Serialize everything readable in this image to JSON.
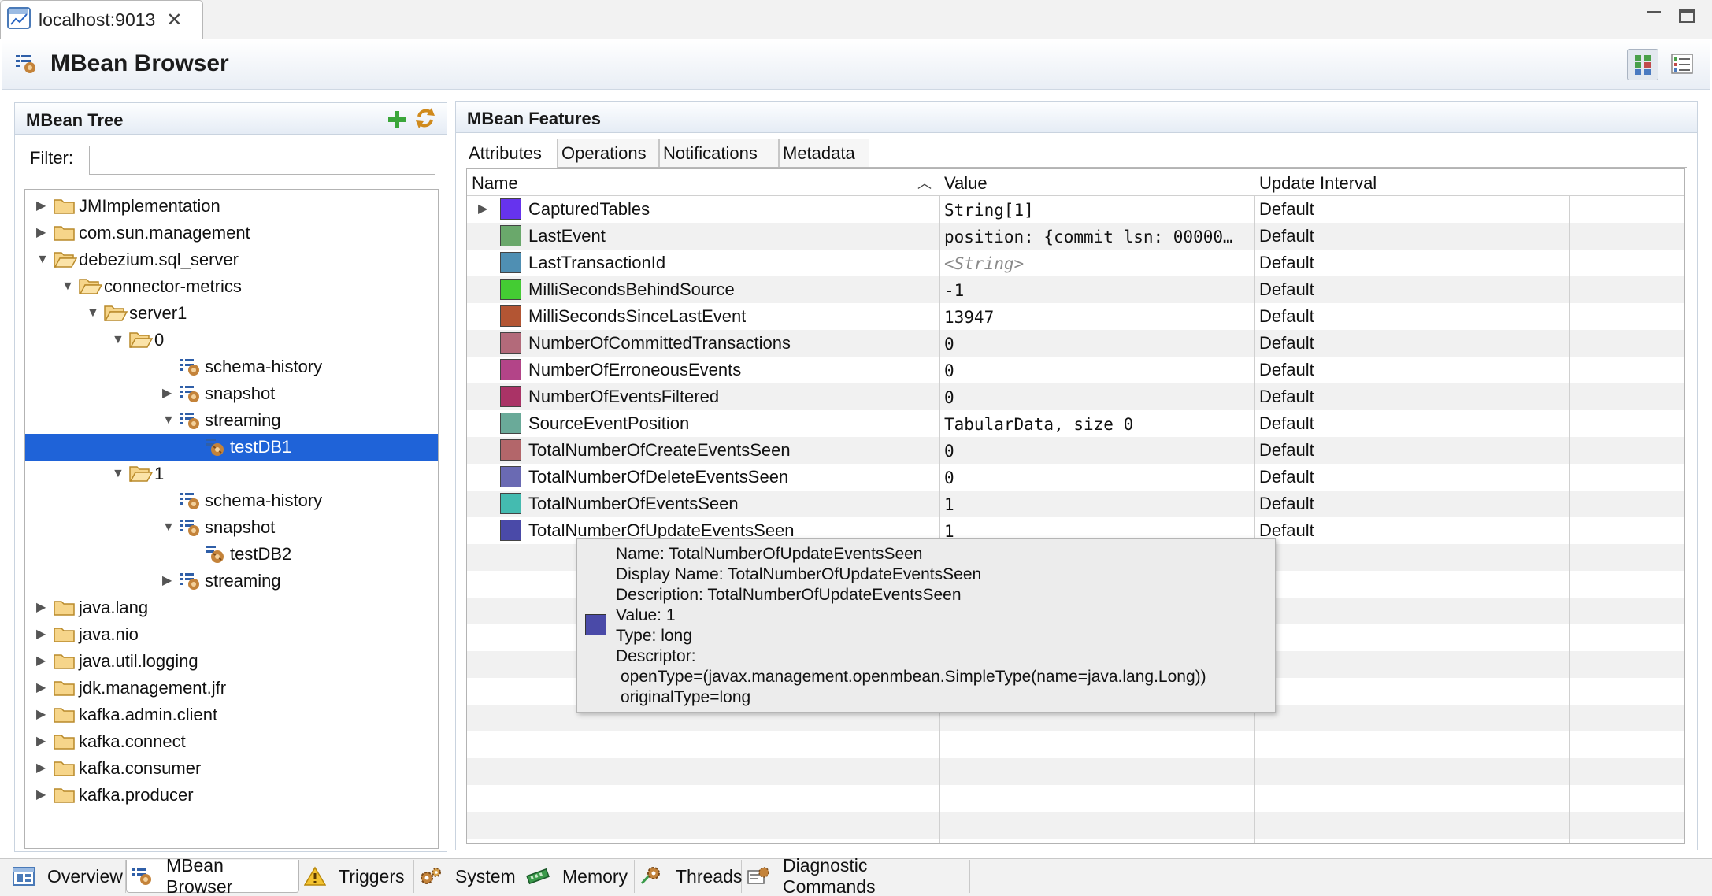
{
  "window": {
    "tab_title": "localhost:9013"
  },
  "header": {
    "title": "MBean Browser"
  },
  "tree_panel": {
    "title": "MBean Tree",
    "filter_label": "Filter:",
    "filter_value": "",
    "items": [
      {
        "label": "JMImplementation",
        "type": "folder",
        "expanded": false
      },
      {
        "label": "com.sun.management",
        "type": "folder",
        "expanded": false
      },
      {
        "label": "debezium.sql_server",
        "type": "folder",
        "expanded": true
      },
      {
        "label": "connector-metrics",
        "type": "folder",
        "expanded": true
      },
      {
        "label": "server1",
        "type": "folder",
        "expanded": true
      },
      {
        "label": "0",
        "type": "folder",
        "expanded": true
      },
      {
        "label": "schema-history",
        "type": "bean"
      },
      {
        "label": "snapshot",
        "type": "bean",
        "expanded": false
      },
      {
        "label": "streaming",
        "type": "bean",
        "expanded": true
      },
      {
        "label": "testDB1",
        "type": "mbean",
        "selected": true
      },
      {
        "label": "1",
        "type": "folder",
        "expanded": true
      },
      {
        "label": "schema-history",
        "type": "bean"
      },
      {
        "label": "snapshot",
        "type": "bean",
        "expanded": true
      },
      {
        "label": "testDB2",
        "type": "mbean"
      },
      {
        "label": "streaming",
        "type": "bean",
        "expanded": false
      },
      {
        "label": "java.lang",
        "type": "folder",
        "expanded": false
      },
      {
        "label": "java.nio",
        "type": "folder",
        "expanded": false
      },
      {
        "label": "java.util.logging",
        "type": "folder",
        "expanded": false
      },
      {
        "label": "jdk.management.jfr",
        "type": "folder",
        "expanded": false
      },
      {
        "label": "kafka.admin.client",
        "type": "folder",
        "expanded": false
      },
      {
        "label": "kafka.connect",
        "type": "folder",
        "expanded": false
      },
      {
        "label": "kafka.consumer",
        "type": "folder",
        "expanded": false
      },
      {
        "label": "kafka.producer",
        "type": "folder",
        "expanded": false
      }
    ]
  },
  "features_panel": {
    "title": "MBean Features",
    "tabs": [
      "Attributes",
      "Operations",
      "Notifications",
      "Metadata"
    ],
    "active_tab": "Attributes",
    "columns": [
      "Name",
      "Value",
      "Update Interval"
    ],
    "rows": [
      {
        "name": "CapturedTables",
        "value": "String[1]",
        "interval": "Default",
        "color": "#6633ee",
        "expandable": true
      },
      {
        "name": "LastEvent",
        "value": "position: {commit_lsn: 00000…",
        "interval": "Default",
        "color": "#6aa86b"
      },
      {
        "name": "LastTransactionId",
        "value": "<String>",
        "interval": "Default",
        "color": "#4f8fb3",
        "placeholder": true
      },
      {
        "name": "MilliSecondsBehindSource",
        "value": "-1",
        "interval": "Default",
        "color": "#44cc33"
      },
      {
        "name": "MilliSecondsSinceLastEvent",
        "value": "13947",
        "interval": "Default",
        "color": "#b35533"
      },
      {
        "name": "NumberOfCommittedTransactions",
        "value": "0",
        "interval": "Default",
        "color": "#b36a7a"
      },
      {
        "name": "NumberOfErroneousEvents",
        "value": "0",
        "interval": "Default",
        "color": "#b34488"
      },
      {
        "name": "NumberOfEventsFiltered",
        "value": "0",
        "interval": "Default",
        "color": "#aa3366"
      },
      {
        "name": "SourceEventPosition",
        "value": "TabularData, size 0",
        "interval": "Default",
        "color": "#6aaa99"
      },
      {
        "name": "TotalNumberOfCreateEventsSeen",
        "value": "0",
        "interval": "Default",
        "color": "#b3666a"
      },
      {
        "name": "TotalNumberOfDeleteEventsSeen",
        "value": "0",
        "interval": "Default",
        "color": "#6a6ab3"
      },
      {
        "name": "TotalNumberOfEventsSeen",
        "value": "1",
        "interval": "Default",
        "color": "#44bbb0"
      },
      {
        "name": "TotalNumberOfUpdateEventsSeen",
        "value": "1",
        "interval": "Default",
        "color": "#4a4aa8"
      }
    ]
  },
  "tooltip": {
    "lines": [
      "Name: TotalNumberOfUpdateEventsSeen",
      "Display Name: TotalNumberOfUpdateEventsSeen",
      "Description: TotalNumberOfUpdateEventsSeen",
      "Value: 1",
      "Type: long",
      "Descriptor:",
      " openType=(javax.management.openmbean.SimpleType(name=java.lang.Long))",
      " originalType=long"
    ],
    "color": "#4a4aa8"
  },
  "bottom_tabs": [
    {
      "label": "Overview",
      "icon": "overview-icon"
    },
    {
      "label": "MBean Browser",
      "icon": "mbean-icon",
      "active": true
    },
    {
      "label": "Triggers",
      "icon": "warning-icon"
    },
    {
      "label": "System",
      "icon": "gears-icon"
    },
    {
      "label": "Memory",
      "icon": "memory-icon"
    },
    {
      "label": "Threads",
      "icon": "threads-icon"
    },
    {
      "label": "Diagnostic Commands",
      "icon": "diagnostic-icon"
    }
  ]
}
